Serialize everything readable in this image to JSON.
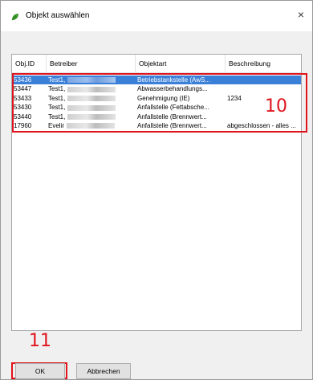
{
  "window": {
    "title": "Objekt auswählen",
    "close_glyph": "×",
    "icon": "green-leaf-icon"
  },
  "table": {
    "columns": [
      "Obj.ID",
      "Betreiber",
      "Objektart",
      "Beschreibung"
    ],
    "rows": [
      {
        "id": "53436",
        "betreiber": "Test1,",
        "objektart": "Betriebstankstelle (AwS...",
        "beschreibung": "",
        "selected": true
      },
      {
        "id": "53447",
        "betreiber": "Test1,",
        "objektart": "Abwasserbehandlungs...",
        "beschreibung": "",
        "selected": false
      },
      {
        "id": "53433",
        "betreiber": "Test1,",
        "objektart": "Genehmigung (IE)",
        "beschreibung": "1234",
        "selected": false
      },
      {
        "id": "53430",
        "betreiber": "Test1,",
        "objektart": "Anfallstelle (Fettabsche...",
        "beschreibung": "",
        "selected": false
      },
      {
        "id": "53440",
        "betreiber": "Test1,",
        "objektart": "Anfallstelle (Brennwert...",
        "beschreibung": "",
        "selected": false
      },
      {
        "id": "17960",
        "betreiber": "Evelir",
        "objektart": "Anfallstelle (Brennwert...",
        "beschreibung": "abgeschlossen - alles ...",
        "selected": false
      }
    ]
  },
  "buttons": {
    "ok": "OK",
    "cancel": "Abbrechen"
  },
  "annotations": {
    "list_number": "10",
    "ok_number": "11",
    "color": "#e0141c"
  },
  "colors": {
    "selection": "#3a7fd8"
  }
}
